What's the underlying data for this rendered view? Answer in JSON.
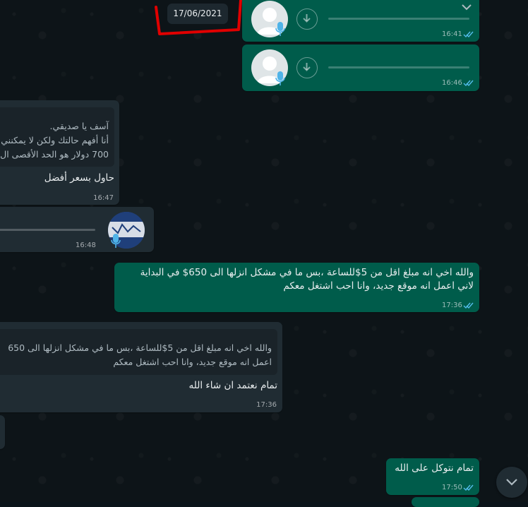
{
  "date_chip": "17/06/2021",
  "messages": {
    "voice1": {
      "time": "16:41"
    },
    "voice2": {
      "time": "16:46"
    },
    "incoming_reply1": {
      "quote_lines": [
        "آسف يا صديقي.",
        "أنا أفهم حالتك ولكن لا يمكنني",
        "700 دولار هو الحد الأقصى ال"
      ],
      "text": "حاول بسعر أفضل",
      "time": "16:47"
    },
    "incoming_voice": {
      "time": "16:48"
    },
    "outgoing_long": {
      "lines": [
        "والله اخي انه مبلغ اقل من 5$للساعة ،بس ما في مشكل انزلها الى 650$ في البداية",
        "لاني اعمل انه موقع جديد، وانا احب اشتغل معكم"
      ],
      "time": "17:36"
    },
    "incoming_reply2": {
      "quote_lines": [
        "والله اخي انه مبلغ اقل من 5$للساعة ،بس ما في مشكل انزلها الى 650",
        "اعمل انه موقع جديد، وانا احب اشتغل معكم"
      ],
      "text": "تمام نعتمد ان شاء الله",
      "time": "17:36"
    },
    "outgoing_short": {
      "text": "تمام نتوكل على الله",
      "time": "17:50"
    }
  },
  "colors": {
    "outgoing": "#005c4b",
    "incoming": "#202c33",
    "read_ticks": "#53bdeb",
    "annotation": "#e00000"
  },
  "icons": [
    "download-icon",
    "mic-icon",
    "chevron-down-icon",
    "double-check-icon",
    "default-avatar-icon"
  ]
}
